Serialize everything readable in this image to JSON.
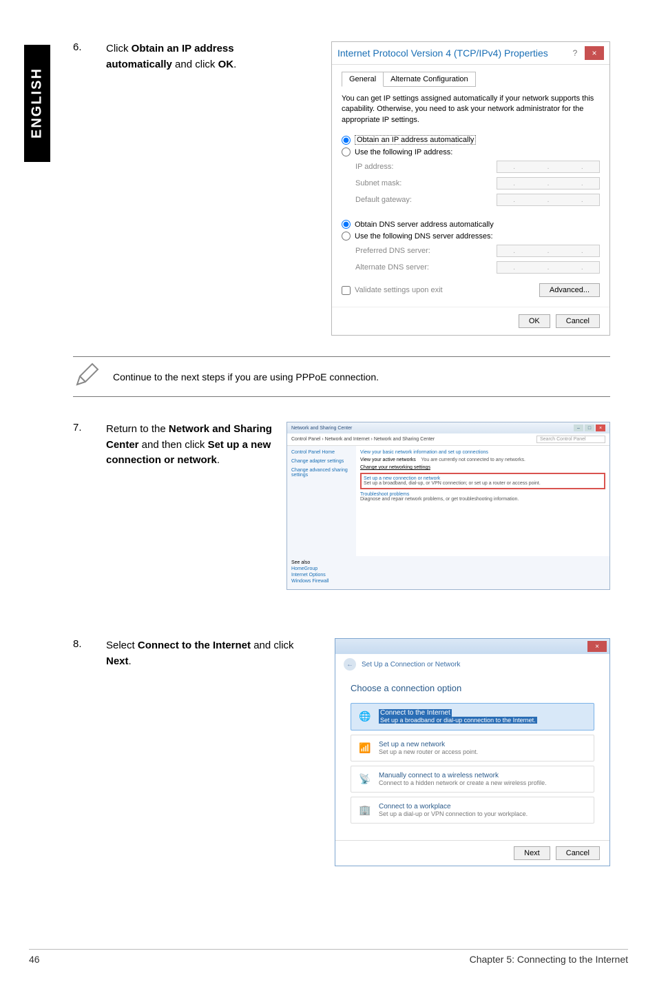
{
  "side_tab": "ENGLISH",
  "step6": {
    "num": "6.",
    "text_a": "Click ",
    "bold_a": "Obtain an IP address automatically",
    "text_b": " and click ",
    "bold_b": "OK",
    "text_c": "."
  },
  "ipv4": {
    "title": "Internet Protocol Version 4 (TCP/IPv4) Properties",
    "help": "?",
    "close": "×",
    "tab_general": "General",
    "tab_alt": "Alternate Configuration",
    "desc": "You can get IP settings assigned automatically if your network supports this capability. Otherwise, you need to ask your network administrator for the appropriate IP settings.",
    "radio_obtain_ip": "Obtain an IP address automatically",
    "radio_use_ip": "Use the following IP address:",
    "lbl_ip": "IP address:",
    "lbl_subnet": "Subnet mask:",
    "lbl_gateway": "Default gateway:",
    "radio_obtain_dns": "Obtain DNS server address automatically",
    "radio_use_dns": "Use the following DNS server addresses:",
    "lbl_pref_dns": "Preferred DNS server:",
    "lbl_alt_dns": "Alternate DNS server:",
    "chk_validate": "Validate settings upon exit",
    "btn_advanced": "Advanced...",
    "btn_ok": "OK",
    "btn_cancel": "Cancel"
  },
  "note": "Continue to the next steps if you are using PPPoE connection.",
  "step7": {
    "num": "7.",
    "text_a": "Return to the ",
    "bold_a": "Network and Sharing Center",
    "text_b": " and then click ",
    "bold_b": "Set up a new connection or network",
    "text_c": "."
  },
  "nsc": {
    "title": "Network and Sharing Center",
    "crumb": "Control Panel  ›  Network and Internet  ›  Network and Sharing Center",
    "search_placeholder": "Search Control Panel",
    "side_home": "Control Panel Home",
    "side_adapter": "Change adapter settings",
    "side_sharing": "Change advanced sharing settings",
    "head": "View your basic network information and set up connections",
    "active_label": "View your active networks",
    "active_text": "You are currently not connected to any networks.",
    "change_label": "Change your networking settings",
    "setup_title": "Set up a new connection or network",
    "setup_sub": "Set up a broadband, dial-up, or VPN connection; or set up a router or access point.",
    "trouble_title": "Troubleshoot problems",
    "trouble_sub": "Diagnose and repair network problems, or get troubleshooting information.",
    "seealso": "See also",
    "sa1": "HomeGroup",
    "sa2": "Internet Options",
    "sa3": "Windows Firewall"
  },
  "step8": {
    "num": "8.",
    "text_a": "Select ",
    "bold_a": "Connect to the Internet",
    "text_b": " and click ",
    "bold_b": "Next",
    "text_c": "."
  },
  "wiz": {
    "close": "×",
    "header": "Set Up a Connection or Network",
    "title": "Choose a connection option",
    "opt1_title": "Connect to the Internet",
    "opt1_sub": "Set up a broadband or dial-up connection to the Internet.",
    "opt2_title": "Set up a new network",
    "opt2_sub": "Set up a new router or access point.",
    "opt3_title": "Manually connect to a wireless network",
    "opt3_sub": "Connect to a hidden network or create a new wireless profile.",
    "opt4_title": "Connect to a workplace",
    "opt4_sub": "Set up a dial-up or VPN connection to your workplace.",
    "btn_next": "Next",
    "btn_cancel": "Cancel"
  },
  "footer": {
    "page": "46",
    "chapter": "Chapter 5: Connecting to the Internet"
  }
}
